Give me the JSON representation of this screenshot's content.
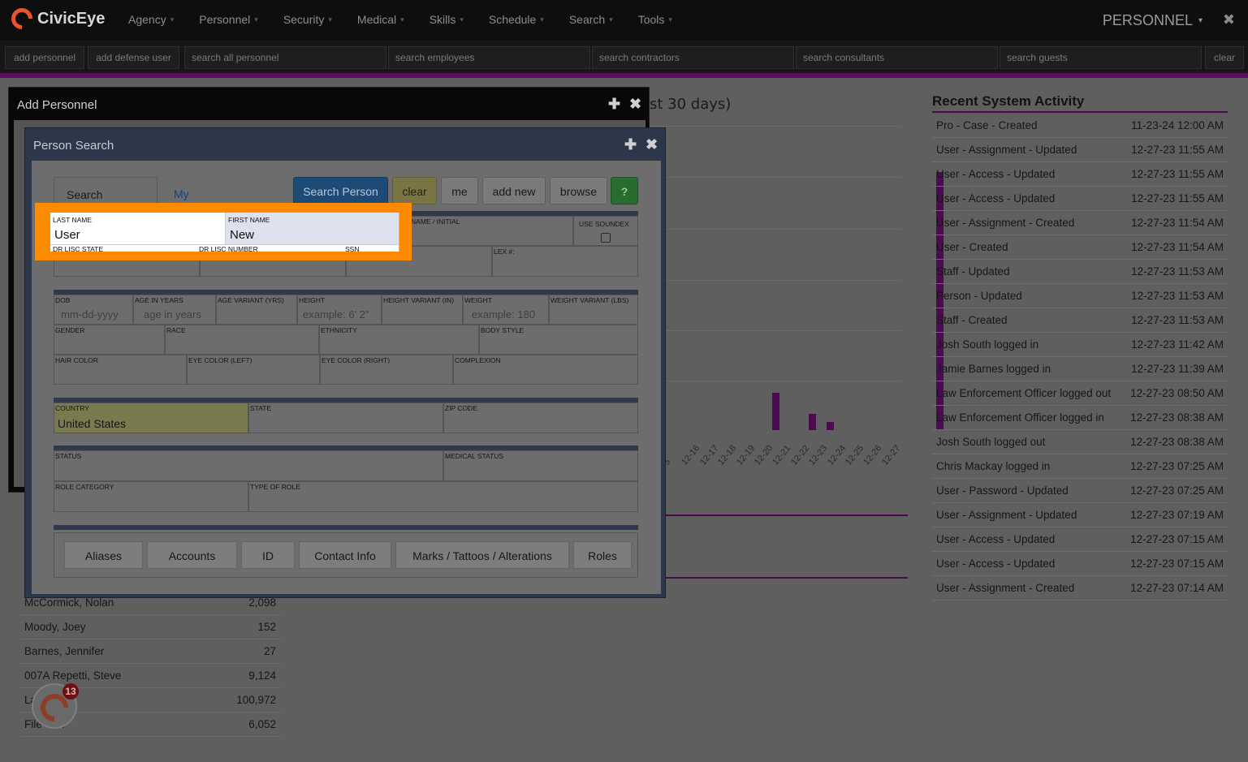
{
  "app": {
    "name": "CivicEye",
    "section": "PERSONNEL",
    "close_glyph": "✖"
  },
  "nav": {
    "items": [
      "Agency",
      "Personnel",
      "Security",
      "Medical",
      "Skills",
      "Schedule",
      "Search",
      "Tools"
    ],
    "caret": "▾"
  },
  "quickbar": {
    "add_personnel": "add personnel",
    "add_defense_user": "add defense user",
    "search_all_personnel": "search all personnel",
    "search_employees": "search employees",
    "search_contractors": "search contractors",
    "search_consultants": "search consultants",
    "search_guests": "search guests",
    "clear": "clear"
  },
  "dashboard": {
    "chart_title_fragment": "st 30 days)",
    "activity_title": "Recent System Activity",
    "activity": [
      {
        "event": "Pro - Case - Created",
        "time": "11-23-24 12:00 AM"
      },
      {
        "event": "User - Assignment - Updated",
        "time": "12-27-23 11:55 AM"
      },
      {
        "event": "User - Access - Updated",
        "time": "12-27-23 11:55 AM"
      },
      {
        "event": "User - Access - Updated",
        "time": "12-27-23 11:55 AM"
      },
      {
        "event": "User - Assignment - Created",
        "time": "12-27-23 11:54 AM"
      },
      {
        "event": "User - Created",
        "time": "12-27-23 11:54 AM"
      },
      {
        "event": "Staff - Updated",
        "time": "12-27-23 11:53 AM"
      },
      {
        "event": "Person - Updated",
        "time": "12-27-23 11:53 AM"
      },
      {
        "event": "Staff - Created",
        "time": "12-27-23 11:53 AM"
      },
      {
        "event": "Josh South logged in",
        "time": "12-27-23 11:42 AM"
      },
      {
        "event": "Jamie Barnes logged in",
        "time": "12-27-23 11:39 AM"
      },
      {
        "event": "Law Enforcement Officer logged out",
        "time": "12-27-23 08:50 AM"
      },
      {
        "event": "Law Enforcement Officer logged in",
        "time": "12-27-23 08:38 AM"
      },
      {
        "event": "Josh South logged out",
        "time": "12-27-23 08:38 AM"
      },
      {
        "event": "Chris Mackay logged in",
        "time": "12-27-23 07:25 AM"
      },
      {
        "event": "User - Password - Updated",
        "time": "12-27-23 07:25 AM"
      },
      {
        "event": "User - Assignment - Updated",
        "time": "12-27-23 07:19 AM"
      },
      {
        "event": "User - Access - Updated",
        "time": "12-27-23 07:15 AM"
      },
      {
        "event": "User - Access - Updated",
        "time": "12-27-23 07:15 AM"
      },
      {
        "event": "User - Assignment - Created",
        "time": "12-27-23 07:14 AM"
      }
    ],
    "personnel_list": [
      {
        "name": "McCormick, Nolan",
        "value": "2,098"
      },
      {
        "name": "Moody, Joey",
        "value": "152"
      },
      {
        "name": "Barnes, Jennifer",
        "value": "27"
      },
      {
        "name": "007A Repetti, Steve",
        "value": "9,124"
      },
      {
        "name": "La  dy",
        "value": "100,972"
      },
      {
        "name": "File ter",
        "value": "6,052"
      }
    ],
    "badge_count": "13"
  },
  "chart_data": {
    "type": "bar",
    "categories": [
      "12-15",
      "12-16",
      "12-17",
      "12-18",
      "12-19",
      "12-20",
      "12-21",
      "12-22",
      "12-23",
      "12-24",
      "12-25",
      "12-26",
      "12-27"
    ],
    "values": [
      0,
      0,
      0,
      7,
      0,
      3,
      1.5,
      0,
      0,
      0,
      0,
      0,
      48
    ],
    "ylim": [
      0,
      52
    ],
    "tick_labels": [
      "5",
      "12-16",
      "12-17",
      "12-18",
      "12-19",
      "12-20",
      "12-21",
      "12-22",
      "12-23",
      "12-24",
      "12-25",
      "12-26",
      "12-27"
    ],
    "bar_color": "#4c0b50"
  },
  "add_window": {
    "title": "Add Personnel",
    "plus": "✚",
    "close": "✖"
  },
  "person_search": {
    "title": "Person Search",
    "plus": "✚",
    "close": "✖",
    "tabs": {
      "options": "Search Options",
      "saved": "My Searches"
    },
    "buttons": {
      "search": "Search Person",
      "clear": "clear",
      "me": "me",
      "add_new": "add new",
      "browse": "browse",
      "help": "?"
    },
    "name": {
      "last_label": "LAST NAME",
      "last_value": "User",
      "first_label": "FIRST NAME",
      "first_value": "New",
      "middle_label": "MIDDLE NAME / INITIAL",
      "middle_label_visible": "DDLE NAME / INITIAL",
      "soundex_label": "USE SOUNDEX"
    },
    "ids": {
      "dl_state": "DR LISC STATE",
      "dl_number": "DR LISC NUMBER",
      "ssn": "SSN",
      "lex": "LEX #:"
    },
    "physical": {
      "dob": "DOB",
      "dob_ph": "mm-dd-yyyy",
      "age": "AGE IN YEARS",
      "age_ph": "age in years",
      "age_var": "AGE VARIANT (YRS)",
      "height": "HEIGHT",
      "height_ph": "example: 6' 2\"",
      "height_var": "HEIGHT VARIANT (IN)",
      "weight": "WEIGHT",
      "weight_ph": "example: 180",
      "weight_var": "WEIGHT VARIANT (LBS)",
      "gender": "GENDER",
      "race": "RACE",
      "ethnicity": "ETHNICITY",
      "body_style": "BODY STYLE",
      "hair": "HAIR COLOR",
      "eye_left": "EYE COLOR (LEFT)",
      "eye_right": "EYE COLOR (RIGHT)",
      "complexion": "COMPLEXION"
    },
    "location": {
      "country": "COUNTRY",
      "country_value": "United States",
      "state": "STATE",
      "zip": "ZIP CODE"
    },
    "status": {
      "status": "STATUS",
      "medical": "MEDICAL STATUS",
      "role_cat": "ROLE CATEGORY",
      "role_type": "TYPE OF ROLE"
    },
    "subtabs": [
      "Aliases",
      "Accounts",
      "ID",
      "Contact Info",
      "Marks / Tattoos / Alterations",
      "Roles"
    ]
  }
}
